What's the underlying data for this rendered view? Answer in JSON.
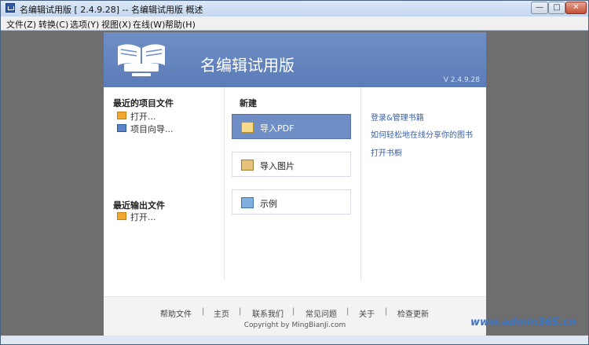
{
  "window": {
    "title": "名编辑试用版 [ 2.4.9.28] -- 名编辑试用版 概述",
    "controls": {
      "minimize": "—",
      "maximize": "□",
      "close": "✕"
    }
  },
  "menu": [
    {
      "label": "文件(Z)"
    },
    {
      "label": "转换(C)"
    },
    {
      "label": "选项(Y)"
    },
    {
      "label": "视图(X)"
    },
    {
      "label": "在线(W)"
    },
    {
      "label": "帮助(H)"
    }
  ],
  "banner": {
    "title": "名编辑试用版",
    "version": "V 2.4.9.28"
  },
  "recent_projects": {
    "heading": "最近的项目文件",
    "items": [
      {
        "label": "打开...",
        "icon": "folder-open-icon"
      },
      {
        "label": "项目向导...",
        "icon": "wizard-icon"
      }
    ]
  },
  "recent_outputs": {
    "heading": "最近输出文件",
    "items": [
      {
        "label": "打开...",
        "icon": "folder-open-icon"
      }
    ]
  },
  "new_section": {
    "heading": "新建",
    "buttons": [
      {
        "label": "导入PDF",
        "icon": "import-pdf-icon"
      },
      {
        "label": "导入图片",
        "icon": "import-image-icon"
      },
      {
        "label": "示例",
        "icon": "sample-monitor-icon"
      }
    ]
  },
  "right_links": [
    {
      "label": "登录&管理书籍"
    },
    {
      "label": "如何轻松地在线分享你的图书"
    },
    {
      "label": "打开书橱"
    }
  ],
  "footer": {
    "links": [
      "帮助文件",
      "主页",
      "联系我们",
      "常见问题",
      "关于",
      "检查更新"
    ],
    "separator": "|",
    "copyright": "Copyright by MingBianJi.com"
  },
  "watermark": "www.admin365.cn",
  "colors": {
    "banner": "#6f8ec5",
    "active_button": "#6f8ec5",
    "link": "#3b5f9e",
    "window_frame": "#c9d7ea"
  }
}
